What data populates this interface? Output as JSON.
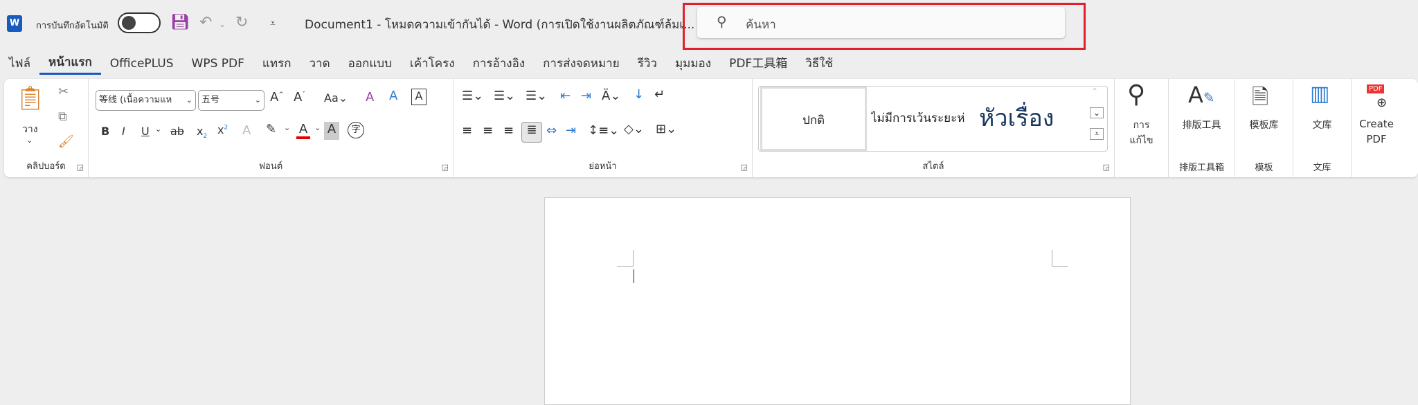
{
  "titlebar": {
    "app_icon": "W",
    "autosave_label": "การบันทึกอัตโนมัติ",
    "autosave_state": "off",
    "title": "Document1  -  โหมดความเข้ากันได้  -  Word (การเปิดใช้งานผลิตภัณฑ์ล้มเ...",
    "search_placeholder": "ค้นหา"
  },
  "tabs": [
    "ไฟล์",
    "หน้าแรก",
    "OfficePLUS",
    "WPS PDF",
    "แทรก",
    "วาด",
    "ออกแบบ",
    "เค้าโครง",
    "การอ้างอิง",
    "การส่งจดหมาย",
    "รีวิว",
    "มุมมอง",
    "PDF工具箱",
    "วิธีใช้"
  ],
  "active_tab": "หน้าแรก",
  "ribbon": {
    "clipboard": {
      "paste": "วาง",
      "label": "คลิปบอร์ด"
    },
    "font": {
      "font_name": "等线 (เนื้อความแห",
      "font_size": "五号",
      "change_case": "Aa",
      "label": "ฟอนต์"
    },
    "paragraph": {
      "label": "ย่อหน้า"
    },
    "styles": {
      "items": [
        "ปกติ",
        "ไม่มีการเว้นระยะห่",
        "หัวเรื่อง"
      ],
      "label": "สไตล์"
    },
    "editing": {
      "label_line1": "การ",
      "label_line2": "แก้ไข"
    },
    "typeset": {
      "button": "排版工具",
      "label": "排版工具箱"
    },
    "templates": {
      "button": "模板库",
      "label": "模板"
    },
    "library": {
      "button": "文库",
      "label": "文库"
    },
    "create_pdf": {
      "line1": "Create",
      "line2": "PDF",
      "badge": "PDF"
    }
  },
  "colors": {
    "accent": "#185abd",
    "font_color": "#e00000",
    "highlight": "#e0202a"
  }
}
